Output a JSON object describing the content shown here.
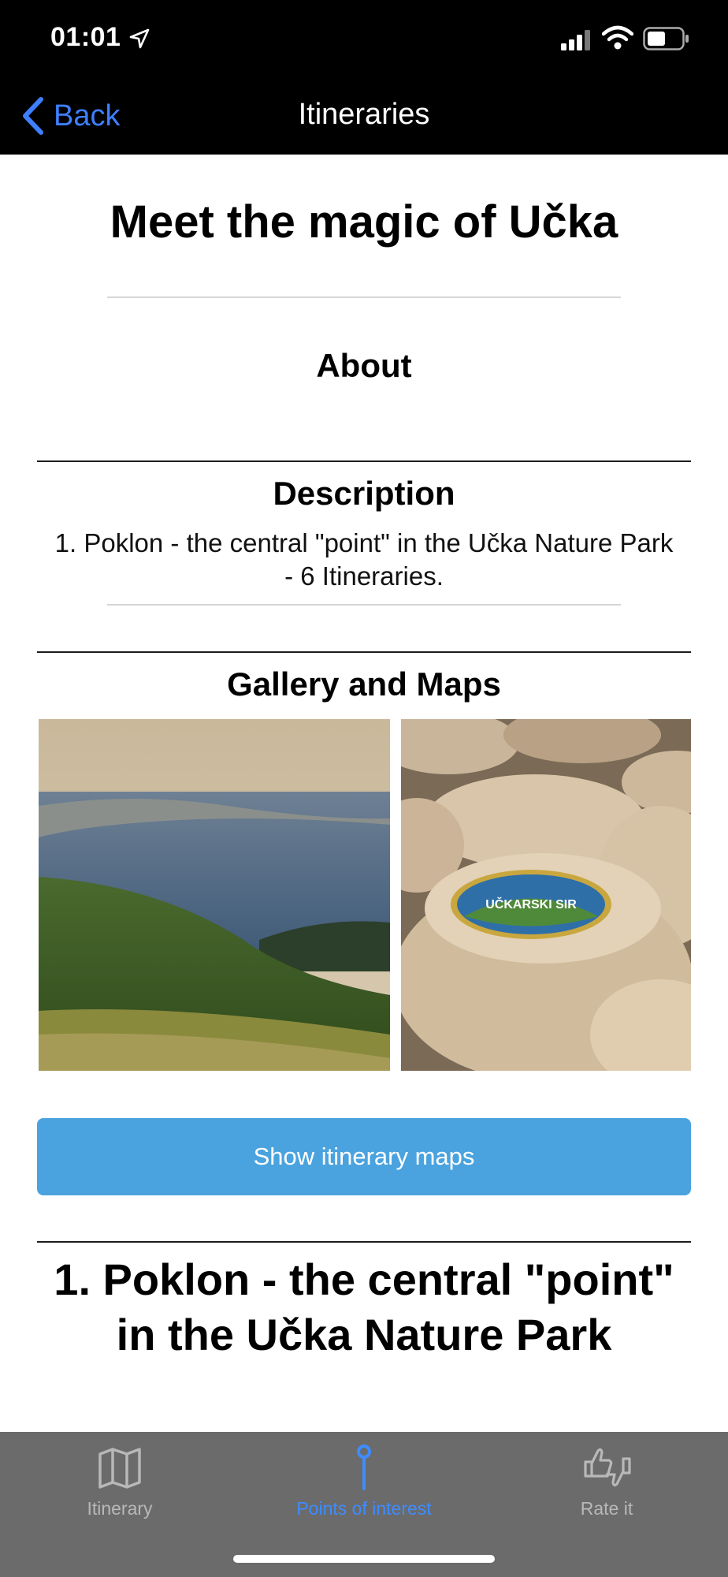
{
  "status_bar": {
    "time": "01:01"
  },
  "nav": {
    "back_label": "Back",
    "title": "Itineraries"
  },
  "page": {
    "title": "Meet the magic of Učka"
  },
  "about": {
    "title": "About"
  },
  "description": {
    "title": "Description",
    "text": "1. Poklon - the central \"point\" in the Učka Nature Park - 6 Itineraries."
  },
  "gallery": {
    "title": "Gallery and Maps",
    "images": [
      {
        "subject": "coastal landscape view from Učka"
      },
      {
        "subject": "cheese wheels",
        "label_text": "UČKARSKI SIR"
      }
    ]
  },
  "map_button": {
    "label": "Show itinerary maps"
  },
  "poi": {
    "title": "1. Poklon - the central \"point\" in the Učka Nature Park"
  },
  "tabs": [
    {
      "label": "Itinerary",
      "icon": "map-icon",
      "active": false
    },
    {
      "label": "Points of interest",
      "icon": "pin-icon",
      "active": true
    },
    {
      "label": "Rate it",
      "icon": "thumbs-icon",
      "active": false
    }
  ],
  "colors": {
    "accent": "#3e7fff",
    "button": "#4aa3de",
    "tabbar": "#6b6b6b",
    "tab_active": "#3e8cff"
  }
}
